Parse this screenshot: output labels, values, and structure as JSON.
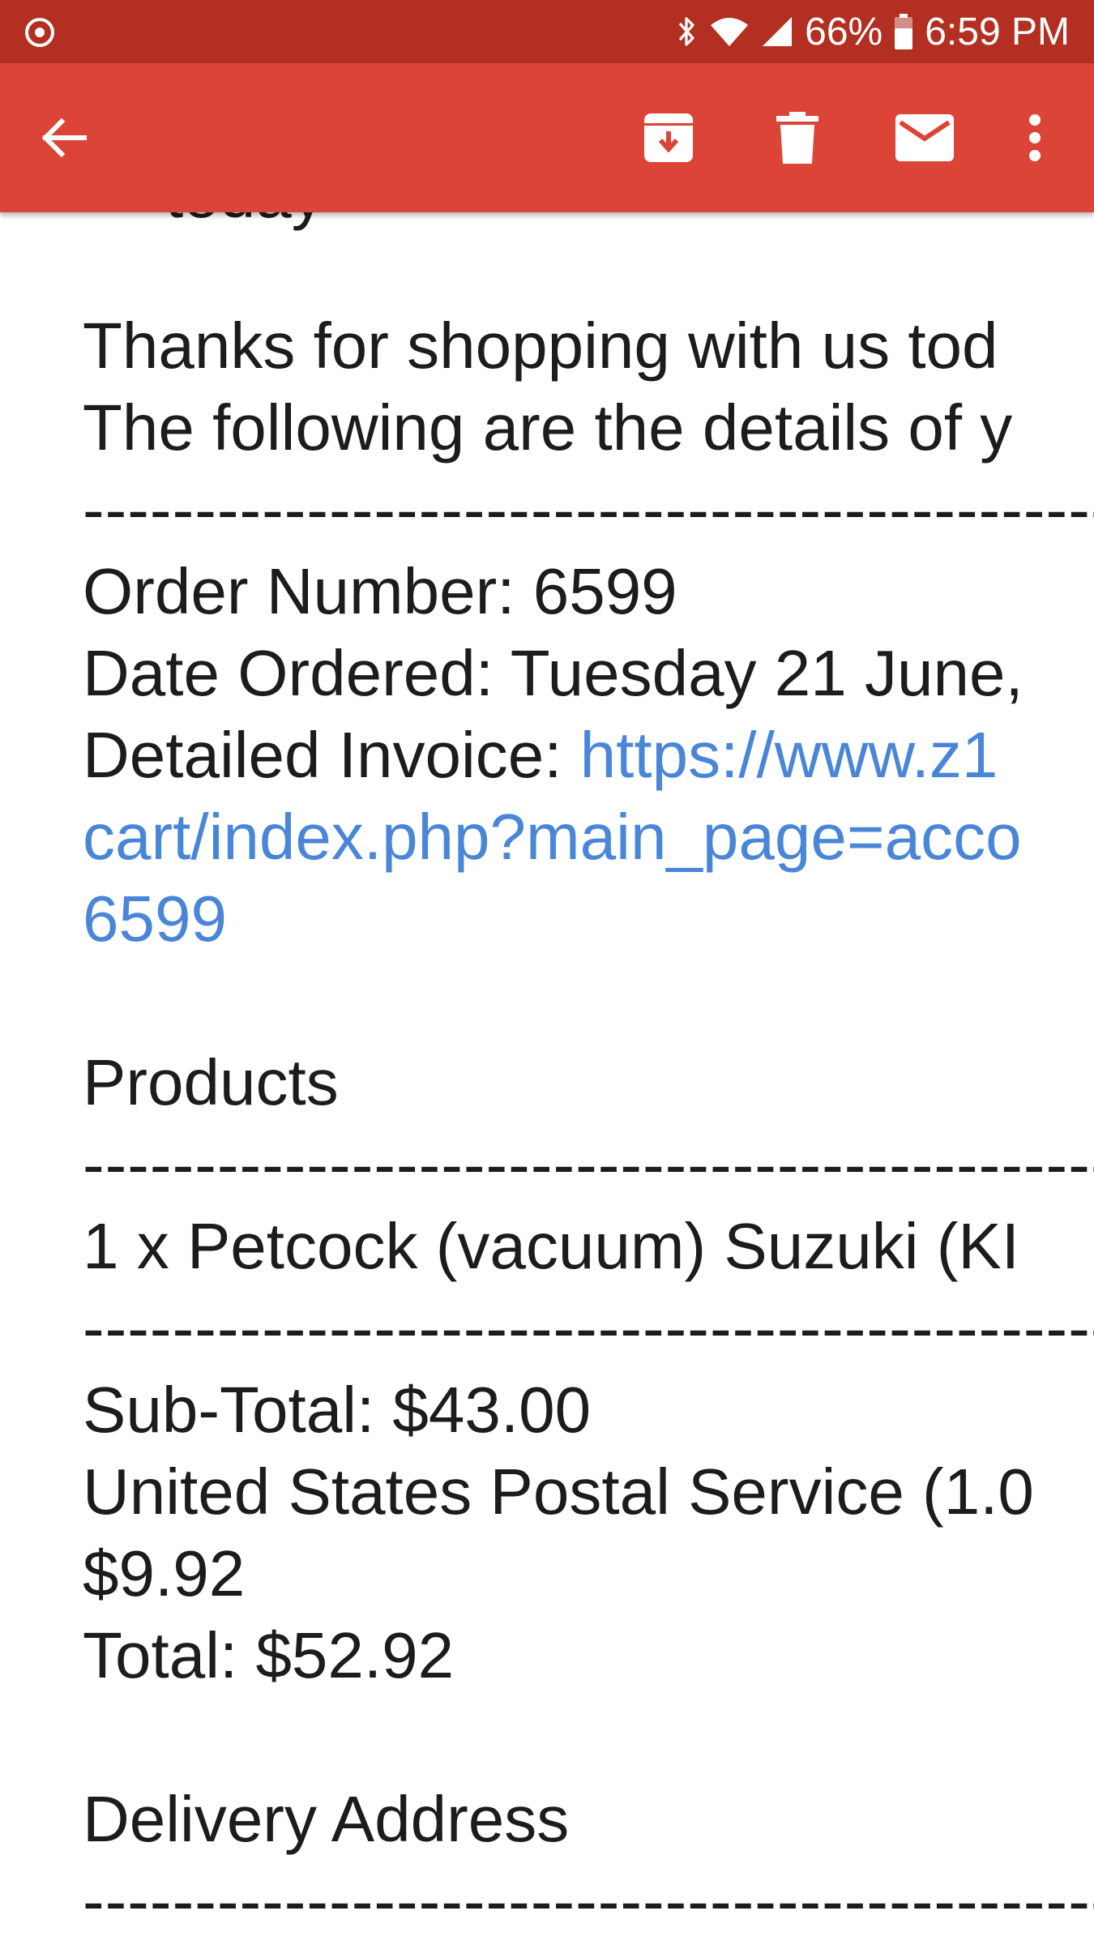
{
  "status_bar": {
    "battery": "66%",
    "time": "6:59 PM"
  },
  "app_bar": {
    "back_icon": "arrow-back-icon",
    "archive_icon": "archive-icon",
    "delete_icon": "trash-icon",
    "mark_unread_icon": "mail-icon",
    "more_icon": "more-vert-icon"
  },
  "email": {
    "cut_off_text": "today",
    "greeting_line1": "Thanks for shopping with us tod",
    "greeting_line2": "The following are the details of y",
    "separator": "----------------------------------------------------------------------------",
    "order_number": "Order Number: 6599",
    "date_ordered": "Date Ordered: Tuesday 21 June,",
    "invoice_label": "Detailed Invoice: ",
    "invoice_link_1": "https://www.z1",
    "invoice_link_2": "cart/index.php?main_page=acco",
    "invoice_link_3": "6599",
    "products_heading": "Products",
    "product_line": "1 x Petcock (vacuum) Suzuki (KI",
    "subtotal": "Sub-Total: $43.00",
    "shipping_line1": "United States Postal Service (1.0",
    "shipping_line2": "$9.92",
    "total": "Total: $52.92",
    "delivery_heading": "Delivery Address"
  },
  "colors": {
    "status_bar": "#b22f21",
    "app_bar": "#db4437",
    "link": "#4a86d8"
  }
}
